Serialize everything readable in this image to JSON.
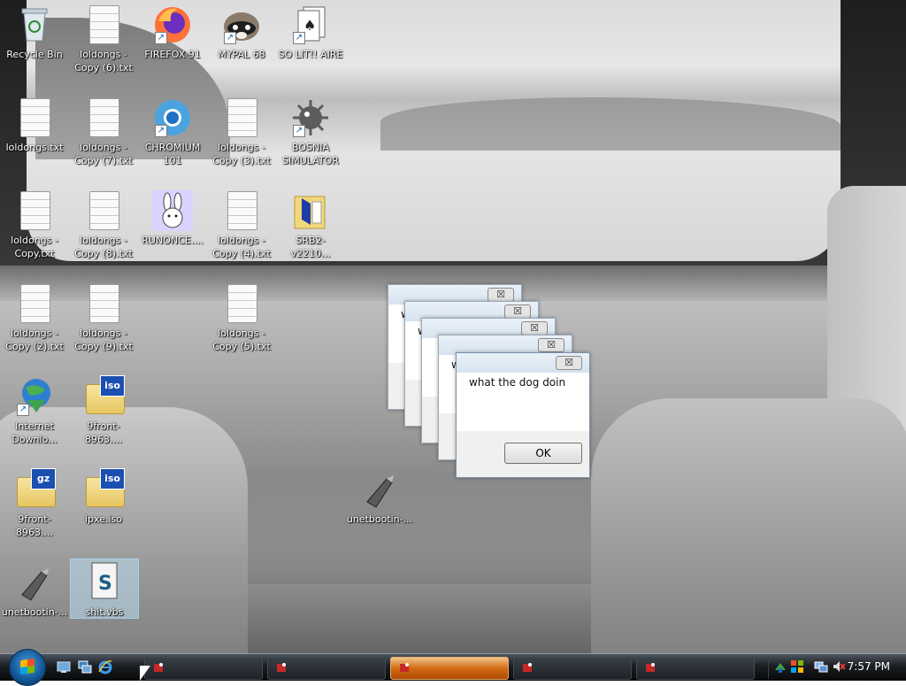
{
  "desktop": {
    "icons": [
      {
        "label": "Recycle Bin",
        "type": "recycle"
      },
      {
        "label": "loldongs - Copy (6).txt",
        "type": "txt"
      },
      {
        "label": "FIREFOX 91",
        "type": "firefox",
        "shortcut": true
      },
      {
        "label": "MYPAL 68",
        "type": "mypal",
        "shortcut": true
      },
      {
        "label": "SO LIT!! AIRE",
        "type": "cards",
        "shortcut": true
      },
      {
        "label": "loldongs.txt",
        "type": "txt"
      },
      {
        "label": "loldongs - Copy (7).txt",
        "type": "txt"
      },
      {
        "label": "CHROMIUM 101",
        "type": "chromium",
        "shortcut": true
      },
      {
        "label": "loldongs - Copy (3).txt",
        "type": "txt"
      },
      {
        "label": "BOSNIA SIMULATOR",
        "type": "mine",
        "shortcut": true
      },
      {
        "label": "loldongs - Copy.txt",
        "type": "txt"
      },
      {
        "label": "loldongs - Copy (8).txt",
        "type": "txt"
      },
      {
        "label": "RUNONCE....",
        "type": "bunny"
      },
      {
        "label": "loldongs - Copy (4).txt",
        "type": "txt"
      },
      {
        "label": "SRB2-v2210...",
        "type": "folder-srb2"
      },
      {
        "label": "loldongs - Copy (2).txt",
        "type": "txt"
      },
      {
        "label": "loldongs - Copy (9).txt",
        "type": "txt"
      },
      {
        "label": "loldongs - Copy (5).txt",
        "type": "txt"
      },
      {
        "label": "Internet Downlo...",
        "type": "idm",
        "shortcut": true
      },
      {
        "label": "9front-8963....",
        "type": "iso",
        "tag": "iso"
      },
      {
        "label": "9front-8963....",
        "type": "gz",
        "tag": "gz"
      },
      {
        "label": "ipxe.iso",
        "type": "iso",
        "tag": "iso"
      },
      {
        "label": "unetbootin-...",
        "type": "unetbootin"
      },
      {
        "label": "unetbootin-...",
        "type": "unetbootin"
      },
      {
        "label": "shit.vbs",
        "type": "vbs",
        "selected": true
      }
    ]
  },
  "dialogs": [
    {
      "message": "wh",
      "close": "☒"
    },
    {
      "message": "what",
      "close": "☒"
    },
    {
      "message": "",
      "close": "☒"
    },
    {
      "message": "w",
      "close": "☒"
    },
    {
      "message": "what the dog doin",
      "close": "☒",
      "ok_label": "OK"
    }
  ],
  "taskbar": {
    "buttons": 5,
    "active_index": 2,
    "clock": "7:57 PM"
  },
  "colors": {
    "accent": "#d46a12",
    "taskbar": "#1b1e22",
    "dialog_title": "#d6e3f0"
  }
}
